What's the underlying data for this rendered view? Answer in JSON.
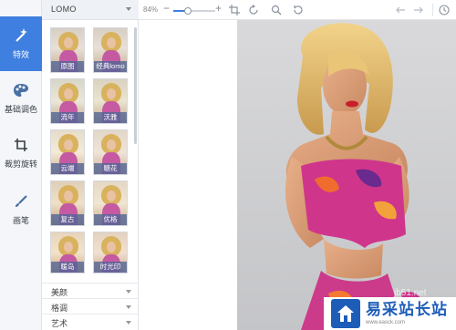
{
  "sidebar": {
    "items": [
      {
        "label": "特效",
        "icon": "magic-wand-icon",
        "active": true
      },
      {
        "label": "基础调色",
        "icon": "palette-icon",
        "active": false
      },
      {
        "label": "裁剪旋转",
        "icon": "crop-icon",
        "active": false
      },
      {
        "label": "画笔",
        "icon": "brush-icon",
        "active": false
      }
    ]
  },
  "panel": {
    "category": "LOMO",
    "filters": [
      "原图",
      "经典lomo",
      "流年",
      "沃雅",
      "云端",
      "糖花",
      "复古",
      "优格",
      "暖岛",
      "时光印"
    ],
    "sections": [
      "美颜",
      "格调",
      "艺术"
    ]
  },
  "toolbar": {
    "zoom_label": "84%",
    "zoom_minus": "−",
    "zoom_plus": "+",
    "zoom_level": 0.84,
    "icons": [
      "crop-fit-icon",
      "rotate-icon",
      "zoom-in-icon",
      "refresh-icon",
      "undo-icon",
      "redo-icon",
      "history-icon"
    ]
  },
  "watermark": {
    "title": "易采站长站",
    "subtitle": "www.easck.com",
    "overlay": "jb51.net"
  },
  "colors": {
    "accent": "#3f7fe0",
    "rail_bg": "#f4f6f9",
    "caption_bg": "#50649a",
    "watermark_blue": "#1d5db8"
  }
}
